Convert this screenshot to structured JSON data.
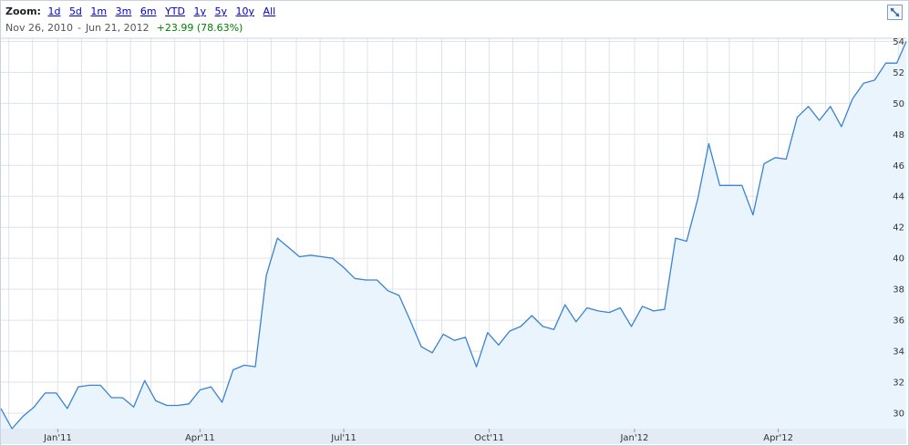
{
  "zoom": {
    "label": "Zoom:",
    "options": [
      "1d",
      "5d",
      "1m",
      "3m",
      "6m",
      "YTD",
      "1y",
      "5y",
      "10y",
      "All"
    ]
  },
  "range": {
    "start": "Nov 26, 2010",
    "separator": "-",
    "end": "Jun 21, 2012",
    "change": "+23.99 (78.63%)"
  },
  "colors": {
    "line": "#3a82d3",
    "area": "#eaf4fc",
    "grid": "#dde3ea",
    "axis_band": "#e3ebf5",
    "change_positive": "#008000"
  },
  "icons": {
    "expand": "expand-icon"
  },
  "chart_data": {
    "type": "area",
    "title": "",
    "xlabel": "",
    "ylabel": "",
    "ylim": [
      29,
      54.2
    ],
    "yticks": [
      30,
      32,
      34,
      36,
      38,
      40,
      42,
      44,
      46,
      48,
      50,
      52,
      54
    ],
    "y_axis_position": "right",
    "grid": true,
    "xlim": [
      "2010-11-26",
      "2012-06-21"
    ],
    "xticks": [
      {
        "label": "Jan'11",
        "date": "2011-01-01"
      },
      {
        "label": "Apr'11",
        "date": "2011-04-01"
      },
      {
        "label": "Jul'11",
        "date": "2011-07-01"
      },
      {
        "label": "Oct'11",
        "date": "2011-10-01"
      },
      {
        "label": "Jan'12",
        "date": "2012-01-01"
      },
      {
        "label": "Apr'12",
        "date": "2012-04-01"
      }
    ],
    "series": [
      {
        "points": [
          [
            "2010-11-26",
            30.3
          ],
          [
            "2010-12-03",
            29.0
          ],
          [
            "2010-12-10",
            29.8
          ],
          [
            "2010-12-17",
            30.4
          ],
          [
            "2010-12-24",
            31.3
          ],
          [
            "2010-12-31",
            31.3
          ],
          [
            "2011-01-07",
            30.3
          ],
          [
            "2011-01-14",
            31.7
          ],
          [
            "2011-01-21",
            31.8
          ],
          [
            "2011-01-28",
            31.8
          ],
          [
            "2011-02-04",
            31.0
          ],
          [
            "2011-02-11",
            31.0
          ],
          [
            "2011-02-18",
            30.4
          ],
          [
            "2011-02-25",
            32.1
          ],
          [
            "2011-03-04",
            30.8
          ],
          [
            "2011-03-11",
            30.5
          ],
          [
            "2011-03-18",
            30.5
          ],
          [
            "2011-03-25",
            30.6
          ],
          [
            "2011-04-01",
            31.5
          ],
          [
            "2011-04-08",
            31.7
          ],
          [
            "2011-04-15",
            30.7
          ],
          [
            "2011-04-22",
            32.8
          ],
          [
            "2011-04-29",
            33.1
          ],
          [
            "2011-05-06",
            33.0
          ],
          [
            "2011-05-13",
            38.9
          ],
          [
            "2011-05-20",
            41.3
          ],
          [
            "2011-05-27",
            40.7
          ],
          [
            "2011-06-03",
            40.1
          ],
          [
            "2011-06-10",
            40.2
          ],
          [
            "2011-06-17",
            40.1
          ],
          [
            "2011-06-24",
            40.0
          ],
          [
            "2011-07-01",
            39.4
          ],
          [
            "2011-07-08",
            38.7
          ],
          [
            "2011-07-15",
            38.6
          ],
          [
            "2011-07-22",
            38.6
          ],
          [
            "2011-07-29",
            37.9
          ],
          [
            "2011-08-05",
            37.6
          ],
          [
            "2011-08-12",
            36.0
          ],
          [
            "2011-08-19",
            34.3
          ],
          [
            "2011-08-26",
            33.9
          ],
          [
            "2011-09-02",
            35.1
          ],
          [
            "2011-09-09",
            34.7
          ],
          [
            "2011-09-16",
            34.9
          ],
          [
            "2011-09-23",
            33.0
          ],
          [
            "2011-09-30",
            35.2
          ],
          [
            "2011-10-07",
            34.4
          ],
          [
            "2011-10-14",
            35.3
          ],
          [
            "2011-10-21",
            35.6
          ],
          [
            "2011-10-28",
            36.3
          ],
          [
            "2011-11-04",
            35.6
          ],
          [
            "2011-11-11",
            35.4
          ],
          [
            "2011-11-18",
            37.0
          ],
          [
            "2011-11-25",
            35.9
          ],
          [
            "2011-12-02",
            36.8
          ],
          [
            "2011-12-09",
            36.6
          ],
          [
            "2011-12-16",
            36.5
          ],
          [
            "2011-12-23",
            36.8
          ],
          [
            "2011-12-30",
            35.6
          ],
          [
            "2012-01-06",
            36.9
          ],
          [
            "2012-01-13",
            36.6
          ],
          [
            "2012-01-20",
            36.7
          ],
          [
            "2012-01-27",
            41.3
          ],
          [
            "2012-02-03",
            41.1
          ],
          [
            "2012-02-10",
            43.8
          ],
          [
            "2012-02-17",
            47.4
          ],
          [
            "2012-02-24",
            44.7
          ],
          [
            "2012-03-02",
            44.7
          ],
          [
            "2012-03-09",
            44.7
          ],
          [
            "2012-03-16",
            42.8
          ],
          [
            "2012-03-23",
            46.1
          ],
          [
            "2012-03-30",
            46.5
          ],
          [
            "2012-04-06",
            46.4
          ],
          [
            "2012-04-13",
            49.1
          ],
          [
            "2012-04-20",
            49.8
          ],
          [
            "2012-04-27",
            48.9
          ],
          [
            "2012-05-04",
            49.8
          ],
          [
            "2012-05-11",
            48.5
          ],
          [
            "2012-05-18",
            50.3
          ],
          [
            "2012-05-25",
            51.3
          ],
          [
            "2012-06-01",
            51.5
          ],
          [
            "2012-06-08",
            52.6
          ],
          [
            "2012-06-15",
            52.6
          ],
          [
            "2012-06-21",
            54.0
          ]
        ]
      }
    ]
  }
}
